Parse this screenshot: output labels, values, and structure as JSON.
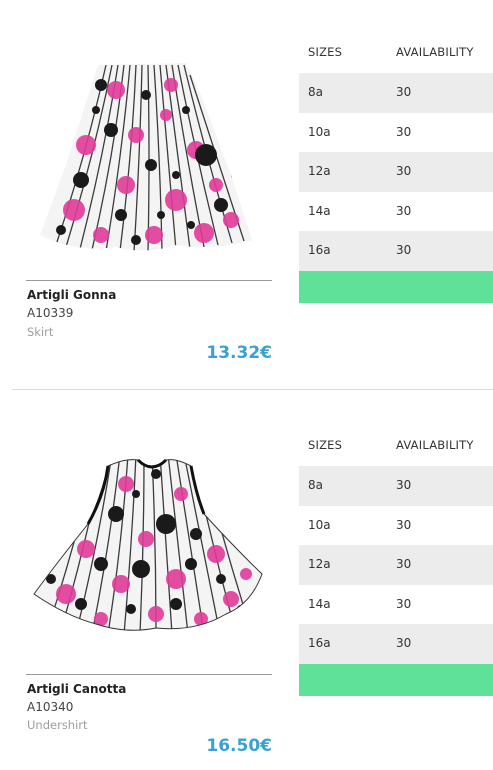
{
  "products": [
    {
      "name": "Artigli Gonna",
      "code": "A10339",
      "type": "Skirt",
      "price": "13.32€",
      "image_icon": "skirt-image",
      "table": {
        "header_sizes": "SIZES",
        "header_availability": "AVAILABILITY",
        "rows": [
          {
            "size": "8a",
            "availability": "30"
          },
          {
            "size": "10a",
            "availability": "30"
          },
          {
            "size": "12a",
            "availability": "30"
          },
          {
            "size": "14a",
            "availability": "30"
          },
          {
            "size": "16a",
            "availability": "30"
          }
        ]
      }
    },
    {
      "name": "Artigli Canotta",
      "code": "A10340",
      "type": "Undershirt",
      "price": "16.50€",
      "image_icon": "undershirt-image",
      "table": {
        "header_sizes": "SIZES",
        "header_availability": "AVAILABILITY",
        "rows": [
          {
            "size": "8a",
            "availability": "30"
          },
          {
            "size": "10a",
            "availability": "30"
          },
          {
            "size": "12a",
            "availability": "30"
          },
          {
            "size": "14a",
            "availability": "30"
          },
          {
            "size": "16a",
            "availability": "30"
          }
        ]
      }
    }
  ],
  "colors": {
    "price": "#39a0d6",
    "button": "#5fe19a",
    "row_alt": "#ececec",
    "print_pink": "#e03b9a",
    "print_black": "#1a1a1a"
  }
}
